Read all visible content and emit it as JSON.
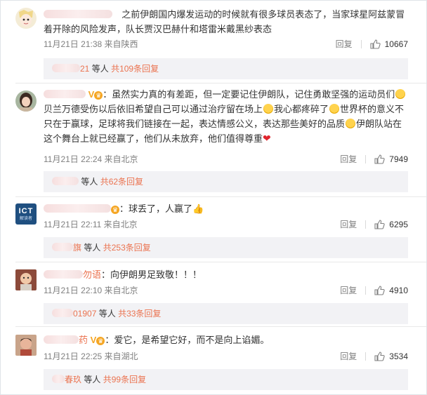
{
  "comments": [
    {
      "text": "之前伊朗国内爆发运动的时候就有很多球员表态了，当家球星阿兹蒙冒着开除的风险发声，队长贾汉巴赫什和塔雷米戴黑纱表态",
      "meta": "11月21日 21:38 来自陕西",
      "reply_label": "回复",
      "likes": "10667",
      "reply_bar": {
        "partial_name": "21",
        "others": "等人",
        "link": "共109条回复"
      }
    },
    {
      "text_1": "：虽然实力真的有差距，但一定要记住伊朗队，记住勇敢坚强的运动员们",
      "text_2": "贝兰万德受伤以后依旧希望自己可以通过治疗留在场上",
      "text_3": "我心都疼碎了",
      "text_4": "世界杯的意义不只在于赢球，足球将我们链接在一起，表达情感公义，表达那些美好的品质",
      "text_5": "伊朗队站在这个舞台上就已经赢了，他们从未放弃，他们值得尊重",
      "meta": "11月21日 22:24 来自北京",
      "reply_label": "回复",
      "likes": "7949",
      "reply_bar": {
        "partial_name": "",
        "others": "等人",
        "link": "共62条回复"
      }
    },
    {
      "text": "：球丢了，人赢了",
      "meta": "11月21日 22:11 来自北京",
      "reply_label": "回复",
      "likes": "6295",
      "avatar_text": "ICT",
      "avatar_sub": "解读者",
      "reply_bar": {
        "partial_name": "旗",
        "others": "等人",
        "link": "共253条回复"
      }
    },
    {
      "name_partial": "勿语",
      "text": "：向伊朗男足致敬！！！",
      "meta": "11月21日 22:10 来自北京",
      "reply_label": "回复",
      "likes": "4910",
      "reply_bar": {
        "partial_name": "01907",
        "others": "等人",
        "link": "共33条回复"
      }
    },
    {
      "name_partial": "药",
      "text": "：爱它，是希望它好，而不是向上谄媚。",
      "meta": "11月21日 22:25 来自湖北",
      "reply_label": "回复",
      "likes": "3534",
      "reply_bar": {
        "partial_name": "春玖",
        "others": "等人",
        "link": "共99条回复"
      }
    }
  ],
  "colors": {
    "accent": "#eb7350",
    "muted": "#808080",
    "reply_bg": "#f2f2f5"
  }
}
